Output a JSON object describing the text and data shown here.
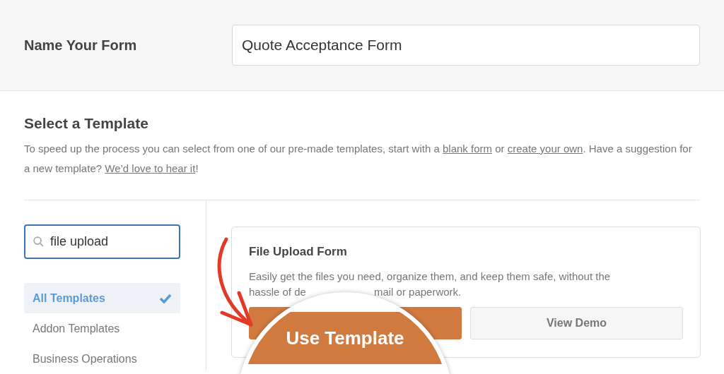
{
  "form_name": {
    "label": "Name Your Form",
    "value": "Quote Acceptance Form"
  },
  "template_section": {
    "title": "Select a Template",
    "intro": [
      {
        "kind": "text",
        "text": "To speed up the process you can select from one of our pre-made templates, start with a "
      },
      {
        "kind": "link",
        "text": "blank form"
      },
      {
        "kind": "text",
        "text": " or "
      },
      {
        "kind": "link",
        "text": "create your own"
      },
      {
        "kind": "text",
        "text": ". Have a suggestion for a new template? "
      },
      {
        "kind": "link",
        "text": "We’d love to hear it"
      },
      {
        "kind": "text",
        "text": "!"
      }
    ]
  },
  "search": {
    "value": "file upload"
  },
  "categories": [
    {
      "label": "All Templates",
      "selected": true
    },
    {
      "label": "Addon Templates",
      "selected": false
    },
    {
      "label": "Business Operations",
      "selected": false
    }
  ],
  "template_card": {
    "title": "File Upload Form",
    "description_line_1": "Easily get the files you need, organize them, and keep them safe, without the",
    "description_line_2_start": "hassle of de",
    "description_line_2_end": "mail or paperwork.",
    "buttons": [
      {
        "kind": "primary",
        "label": "Use Template"
      },
      {
        "kind": "secondary",
        "label": "View Demo"
      }
    ]
  }
}
